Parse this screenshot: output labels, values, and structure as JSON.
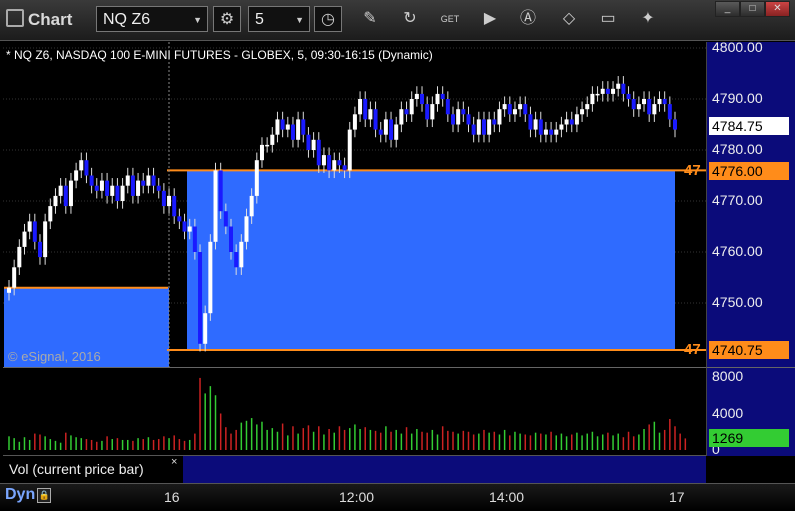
{
  "app": {
    "title": "Chart"
  },
  "toolbar": {
    "symbol": "NQ Z6",
    "interval": "5",
    "icons": [
      "gear-icon",
      "clock-icon",
      "pencil-icon",
      "refresh-icon",
      "get-icon",
      "play-icon",
      "a-icon",
      "eraser-icon",
      "chat-icon",
      "twitter-icon"
    ]
  },
  "window": {
    "minimize": "_",
    "maximize": "□",
    "close": "✕"
  },
  "chart": {
    "title": "* NQ Z6, NASDAQ 100 E-MINI FUTURES - GLOBEX, 5, 09:30-16:15 (Dynamic)",
    "watermark": "© eSignal, 2016",
    "last_price": "4784.75",
    "upper_level": "4776.00",
    "lower_level": "4740.75",
    "level_label_upper": "47",
    "level_label_lower": "47",
    "colors": {
      "up": "#ffffff",
      "down": "#1a1aff",
      "zone": "#2f6bff",
      "level": "#ff8c1a",
      "axis_bg": "#0b0b7a"
    }
  },
  "chart_data": {
    "type": "candlestick",
    "y_ticks": [
      "4800.00",
      "4790.00",
      "4780.00",
      "4770.00",
      "4760.00",
      "4750.00"
    ],
    "ylim": [
      4741,
      4801
    ],
    "x_ticks": [
      "16",
      "12:00",
      "14:00",
      "17"
    ],
    "levels": [
      4776.0,
      4740.75
    ],
    "closes": [
      4753,
      4757,
      4761,
      4764,
      4766,
      4762,
      4759,
      4766,
      4769,
      4771,
      4773,
      4769,
      4774,
      4776,
      4778,
      4775,
      4773,
      4772,
      4774,
      4771,
      4773,
      4770,
      4773,
      4775,
      4771,
      4774,
      4773,
      4775,
      4773,
      4772,
      4769,
      4771,
      4767,
      4766,
      4764,
      4765,
      4760,
      4742,
      4748,
      4762,
      4776,
      4768,
      4765,
      4760,
      4757,
      4762,
      4767,
      4771,
      4778,
      4781,
      4781,
      4783,
      4786,
      4784,
      4785,
      4782,
      4786,
      4783,
      4780,
      4782,
      4777,
      4779,
      4776,
      4778,
      4777,
      4776,
      4784,
      4787,
      4790,
      4786,
      4788,
      4784,
      4783,
      4786,
      4782,
      4785,
      4788,
      4787,
      4790,
      4791,
      4789,
      4786,
      4789,
      4791,
      4790,
      4787,
      4785,
      4788,
      4787,
      4785,
      4783,
      4786,
      4783,
      4786,
      4785,
      4788,
      4789,
      4787,
      4788,
      4789,
      4787,
      4784,
      4786,
      4783,
      4784,
      4783,
      4784,
      4785,
      4786,
      4785,
      4787,
      4788,
      4789,
      4791,
      4791,
      4792,
      4791,
      4792,
      4793,
      4791,
      4790,
      4788,
      4789,
      4790,
      4787,
      4789,
      4790,
      4789,
      4786,
      4784
    ],
    "vol_ticks": [
      "8000",
      "4000",
      "0"
    ],
    "vol_ylim": [
      0,
      8000
    ],
    "last_volume": "1269",
    "volumes": [
      1500,
      1300,
      900,
      1400,
      1100,
      1800,
      1700,
      1500,
      1200,
      1000,
      800,
      1900,
      1600,
      1400,
      1300,
      1200,
      1100,
      900,
      1000,
      1500,
      1200,
      1300,
      1100,
      1100,
      1000,
      1300,
      1200,
      1400,
      1100,
      1200,
      1500,
      1300,
      1600,
      1200,
      1000,
      1100,
      1800,
      7900,
      6200,
      7000,
      6000,
      4000,
      2500,
      1800,
      2200,
      3000,
      3200,
      3500,
      2800,
      3100,
      2200,
      2400,
      2000,
      2900,
      1600,
      2600,
      1800,
      2400,
      2700,
      2000,
      2600,
      1700,
      2300,
      1900,
      2600,
      2200,
      2400,
      2800,
      2300,
      2500,
      2200,
      2100,
      1900,
      2600,
      2000,
      2200,
      1800,
      2500,
      1800,
      2300,
      2000,
      1900,
      2200,
      1700,
      2600,
      2100,
      2000,
      1800,
      2100,
      2000,
      1700,
      1800,
      2200,
      1900,
      2000,
      1700,
      2200,
      1600,
      2000,
      1800,
      1700,
      1600,
      1900,
      1800,
      1700,
      2000,
      1600,
      1800,
      1500,
      1700,
      1900,
      1600,
      1800,
      2000,
      1500,
      1700,
      1900,
      1600,
      1800,
      1400,
      2000,
      1500,
      1700,
      2300,
      2800,
      3100,
      1900,
      2200,
      3400,
      2600,
      1800,
      1269
    ]
  },
  "volume_panel": {
    "legend": "Vol (current price bar)",
    "close": "×"
  },
  "bottom": {
    "dyn_label": "Dyn"
  }
}
